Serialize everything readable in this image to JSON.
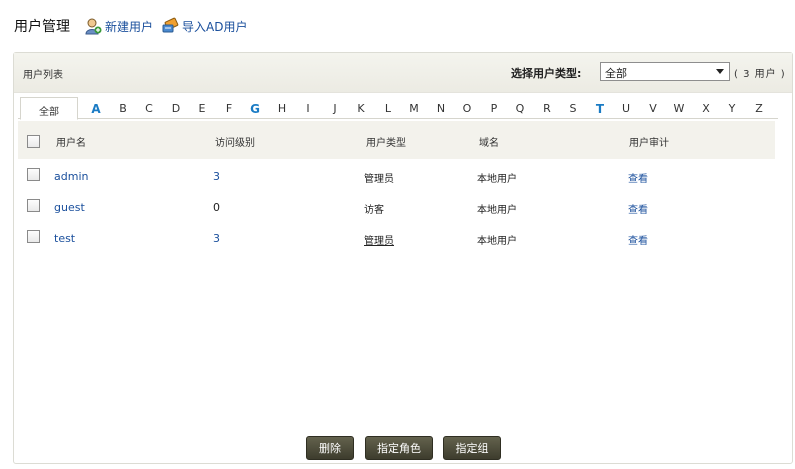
{
  "header": {
    "title": "用户管理",
    "new_user": "新建用户",
    "import_ad": "导入AD用户"
  },
  "panel": {
    "title": "用户列表",
    "type_label": "选择用户类型:",
    "type_value": "全部",
    "user_count": "( 3 用户 )"
  },
  "alpha": {
    "all": "全部",
    "letters": [
      "A",
      "B",
      "C",
      "D",
      "E",
      "F",
      "G",
      "H",
      "I",
      "J",
      "K",
      "L",
      "M",
      "N",
      "O",
      "P",
      "Q",
      "R",
      "S",
      "T",
      "U",
      "V",
      "W",
      "X",
      "Y",
      "Z"
    ],
    "highlighted": [
      "A",
      "G",
      "T"
    ]
  },
  "columns": {
    "username": "用户名",
    "access_level": "访问级别",
    "user_type": "用户类型",
    "domain": "域名",
    "audit": "用户审计"
  },
  "rows": [
    {
      "username": "admin",
      "access_level": "3",
      "user_type": "管理员",
      "domain": "本地用户",
      "audit": "查看"
    },
    {
      "username": "guest",
      "access_level": "0",
      "user_type": "访客",
      "domain": "本地用户",
      "audit": "查看"
    },
    {
      "username": "test",
      "access_level": "3",
      "user_type": "管理员",
      "domain": "本地用户",
      "audit": "查看"
    }
  ],
  "buttons": {
    "delete": "删除",
    "assign_role": "指定角色",
    "assign_group": "指定组"
  },
  "colors": {
    "link": "#1a4f9c",
    "letter_highlight": "#1a7bc4",
    "button": "#4a4937"
  }
}
